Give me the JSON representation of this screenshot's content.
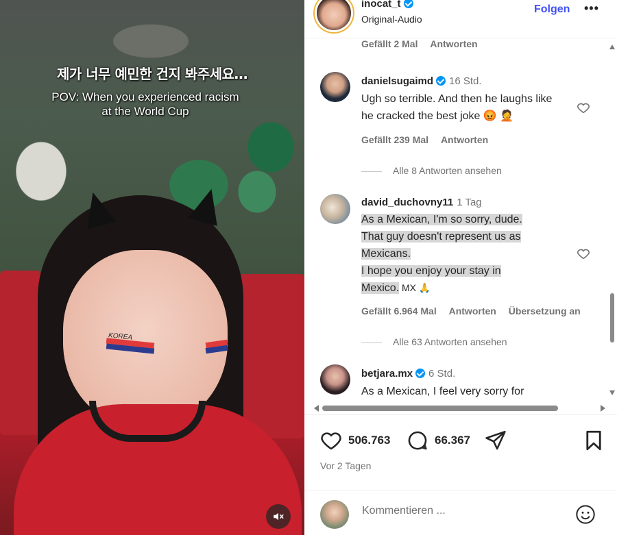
{
  "video": {
    "caption_korean": "제가 너무 예민한 건지 봐주세요…",
    "caption_english": "POV: When you experienced racism\nat the World Cup",
    "face_paint_text": "KOREA",
    "mute_icon": "speaker-muted-icon"
  },
  "header": {
    "username": "inocat_t",
    "subtitle": "Original-Audio",
    "follow_label": "Folgen",
    "more_label": "•••"
  },
  "comments": [
    {
      "meta": {
        "likes": "Gefällt 2 Mal",
        "reply": "Antworten"
      }
    },
    {
      "username": "danielsugaimd",
      "verified": true,
      "time": "16 Std.",
      "text": "Ugh so terrible. And then he laughs like he cracked the best joke 😡 🤦",
      "meta": {
        "likes": "Gefällt 239 Mal",
        "reply": "Antworten"
      },
      "view_replies": "Alle 8 Antworten ansehen"
    },
    {
      "username": "david_duchovny11",
      "verified": false,
      "time": "1 Tag",
      "text_lines": [
        "As a Mexican, I'm so sorry, dude.",
        "That guy doesn't represent us as",
        "Mexicans.",
        "I hope you enjoy your stay in",
        "Mexico."
      ],
      "text_tail": " MX 🙏",
      "meta": {
        "likes": "Gefällt 6.964 Mal",
        "reply": "Antworten",
        "translate": "Übersetzung an"
      },
      "view_replies": "Alle 63 Antworten ansehen"
    },
    {
      "username": "betjara.mx",
      "verified": true,
      "time": "6 Std.",
      "text": "As a Mexican, I feel very sorry for"
    }
  ],
  "actions": {
    "likes_count": "506.763",
    "comments_count": "66.367",
    "posted": "Vor 2 Tagen"
  },
  "compose": {
    "placeholder": "Kommentieren ..."
  },
  "colors": {
    "accent": "#4150f7",
    "verified": "#0095f6",
    "muted_text": "#737373",
    "highlight": "#d6d6d6"
  }
}
